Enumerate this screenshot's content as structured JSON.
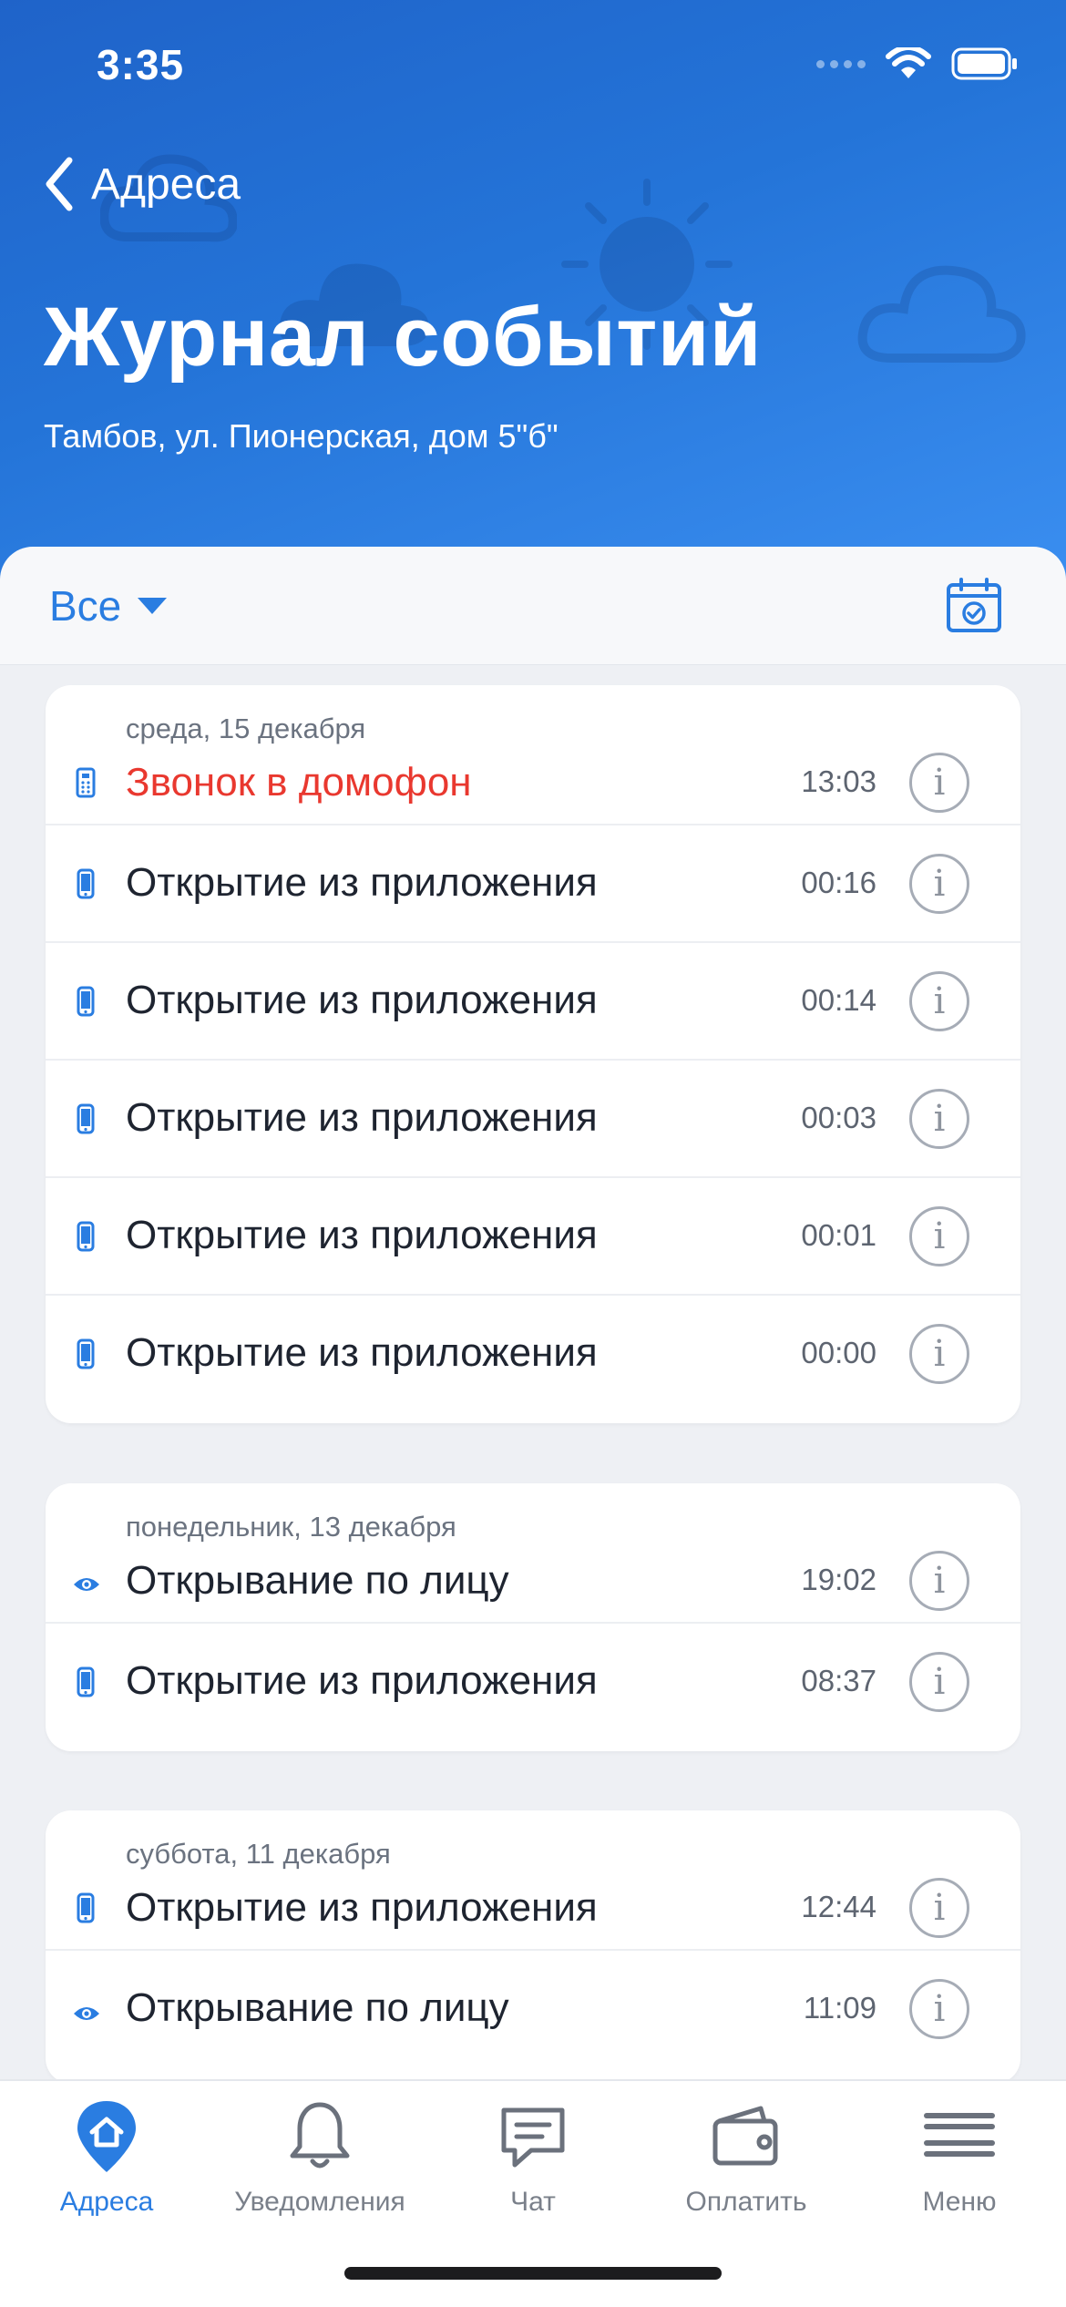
{
  "status_bar": {
    "time": "3:35"
  },
  "header": {
    "back_label": "Адреса",
    "title": "Журнал событий",
    "subtitle": "Тамбов, ул. Пионерская, дом 5\"б\""
  },
  "filter": {
    "selected": "Все"
  },
  "groups": [
    {
      "date": "среда, 15 декабря",
      "events": [
        {
          "icon": "intercom-icon",
          "label": "Звонок в домофон",
          "time": "13:03",
          "color": "#e9382f"
        },
        {
          "icon": "phone-icon",
          "label": "Открытие из приложения",
          "time": "00:16"
        },
        {
          "icon": "phone-icon",
          "label": "Открытие из приложения",
          "time": "00:14"
        },
        {
          "icon": "phone-icon",
          "label": "Открытие из приложения",
          "time": "00:03"
        },
        {
          "icon": "phone-icon",
          "label": "Открытие из приложения",
          "time": "00:01"
        },
        {
          "icon": "phone-icon",
          "label": "Открытие из приложения",
          "time": "00:00"
        }
      ]
    },
    {
      "date": "понедельник, 13 декабря",
      "events": [
        {
          "icon": "eye-icon",
          "label": "Открывание по лицу",
          "time": "19:02"
        },
        {
          "icon": "phone-icon",
          "label": "Открытие из приложения",
          "time": "08:37"
        }
      ]
    },
    {
      "date": "суббота, 11 декабря",
      "events": [
        {
          "icon": "phone-icon",
          "label": "Открытие из приложения",
          "time": "12:44"
        },
        {
          "icon": "eye-icon",
          "label": "Открывание по лицу",
          "time": "11:09"
        }
      ]
    }
  ],
  "tabbar": {
    "items": [
      {
        "label": "Адреса",
        "icon": "home-pin-icon",
        "active": true
      },
      {
        "label": "Уведомления",
        "icon": "bell-icon",
        "active": false
      },
      {
        "label": "Чат",
        "icon": "chat-icon",
        "active": false
      },
      {
        "label": "Оплатить",
        "icon": "wallet-icon",
        "active": false
      },
      {
        "label": "Меню",
        "icon": "menu-icon",
        "active": false
      }
    ]
  },
  "colors": {
    "accent": "#2a7de1",
    "alert": "#e9382f",
    "header_start": "#1f63c9",
    "header_end": "#3a8ef0"
  }
}
